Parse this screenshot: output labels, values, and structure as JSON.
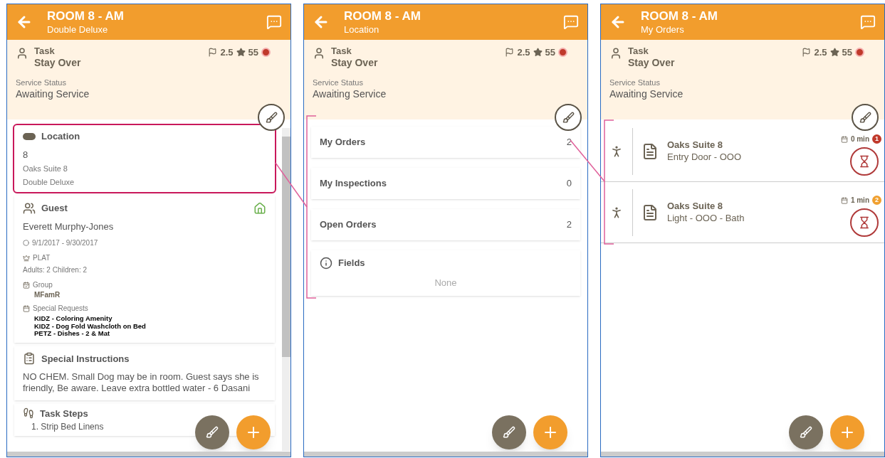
{
  "screens": [
    {
      "kind": "detail",
      "title": "ROOM 8 - AM",
      "subtitle": "Double Deluxe",
      "task": {
        "label": "Task",
        "value": "Stay Over"
      },
      "stats": {
        "rating": "2.5",
        "score": "55"
      },
      "service_status": {
        "label": "Service Status",
        "value": "Awaiting Service"
      },
      "location": {
        "title": "Location",
        "number": "8",
        "name": "Oaks Suite 8",
        "room_type": "Double Deluxe",
        "highlighted": true
      },
      "guest": {
        "title": "Guest",
        "name": "Everett Murphy-Jones",
        "dates": "9/1/2017 - 9/30/2017",
        "tier": "PLAT",
        "occupancy": "Adults: 2 Children: 2",
        "group_label": "Group",
        "group": "MFamR",
        "requests_label": "Special Requests",
        "requests": [
          "KIDZ - Coloring Amenity",
          "KIDZ - Dog Fold Washcloth on Bed",
          "PETZ - Dishes - 2 & Mat"
        ]
      },
      "instructions": {
        "title": "Special Instructions",
        "text": "NO CHEM. Small Dog may be in room. Guest says she is friendly, Be aware. Leave extra bottled water - 6 Dasani"
      },
      "steps": {
        "title": "Task Steps",
        "first": "1. Strip Bed Linens"
      }
    },
    {
      "kind": "menu",
      "title": "ROOM 8 - AM",
      "subtitle": "Location",
      "task": {
        "label": "Task",
        "value": "Stay Over"
      },
      "stats": {
        "rating": "2.5",
        "score": "55"
      },
      "service_status": {
        "label": "Service Status",
        "value": "Awaiting Service"
      },
      "items": [
        {
          "label": "My Orders",
          "count": "2"
        },
        {
          "label": "My Inspections",
          "count": "0"
        },
        {
          "label": "Open Orders",
          "count": "2"
        }
      ],
      "fields": {
        "title": "Fields",
        "value": "None"
      }
    },
    {
      "kind": "orders",
      "title": "ROOM 8 - AM",
      "subtitle": "My Orders",
      "task": {
        "label": "Task",
        "value": "Stay Over"
      },
      "stats": {
        "rating": "2.5",
        "score": "55"
      },
      "service_status": {
        "label": "Service Status",
        "value": "Awaiting Service"
      },
      "orders": [
        {
          "place": "Oaks Suite 8",
          "item": "Entry Door - OOO",
          "time": "0 min",
          "badge": "1",
          "color": "#c0392b"
        },
        {
          "place": "Oaks Suite 8",
          "item": "Light - OOO - Bath",
          "time": "1 min",
          "badge": "2",
          "color": "#f0a030"
        }
      ]
    }
  ]
}
